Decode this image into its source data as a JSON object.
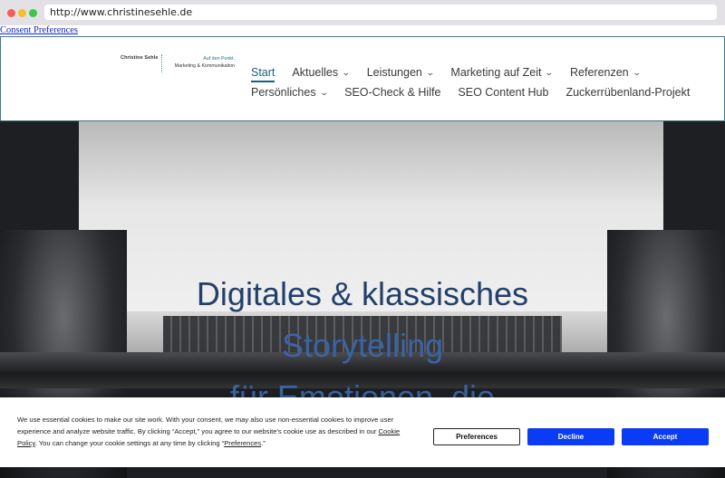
{
  "browser": {
    "url": "http://www.christinesehle.de"
  },
  "consent_link": "Consent Preferences",
  "logo": {
    "name": "Christine Sehle",
    "tagline1": "Auf den Punkt.",
    "tagline2": "Marketing & Kommunikation"
  },
  "nav": {
    "row1": [
      {
        "label": "Start",
        "active": true,
        "dropdown": false
      },
      {
        "label": "Aktuelles",
        "dropdown": true
      },
      {
        "label": "Leistungen",
        "dropdown": true
      },
      {
        "label": "Marketing auf Zeit",
        "dropdown": true
      },
      {
        "label": "Referenzen",
        "dropdown": true
      }
    ],
    "row2": [
      {
        "label": "Persönliches",
        "dropdown": true
      },
      {
        "label": "SEO-Check & Hilfe",
        "dropdown": false
      },
      {
        "label": "SEO Content Hub",
        "dropdown": false
      },
      {
        "label": "Zuckerrübenland-Projekt",
        "dropdown": false
      }
    ]
  },
  "hero": {
    "line1": "Digitales & klassisches",
    "line2": "Storytelling",
    "line3": "für Emotionen, die"
  },
  "cookie": {
    "text_part1": "We use essential cookies to make our site work. With your consent, we may also use non-essential cookies to improve user experience and analyze website traffic. By clicking “Accept,” you agree to our website's cookie use as described in our ",
    "cookie_policy_link": "Cookie Policy",
    "text_part2": ". You can change your cookie settings at any time by clicking “",
    "preferences_link": "Preferences",
    "text_part3": ".”",
    "buttons": {
      "preferences": "Preferences",
      "decline": "Decline",
      "accept": "Accept"
    }
  },
  "colors": {
    "accent": "#1d5f7a",
    "button_blue": "#0b3cf5",
    "hero_text": "#22406a"
  }
}
